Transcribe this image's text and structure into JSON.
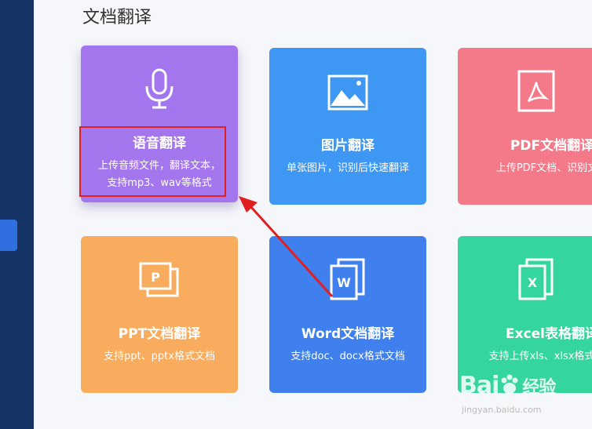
{
  "sidebar": {
    "active_color": "#2f6fe0",
    "bg_color": "#163366"
  },
  "page_title": "文档翻译",
  "cards": [
    {
      "title": "语音翻译",
      "desc_lines": [
        "上传音频文件，翻译文本，",
        "支持mp3、wav等格式"
      ],
      "icon": "microphone-icon",
      "color": "#a476ee"
    },
    {
      "title": "图片翻译",
      "desc_lines": [
        "单张图片，识别后快速翻译"
      ],
      "icon": "image-icon",
      "color": "#3e98f3"
    },
    {
      "title": "PDF文档翻译",
      "desc_lines": [
        "上传PDF文档、识别文档"
      ],
      "icon": "pdf-file-icon",
      "color": "#f47a8a"
    },
    {
      "title": "PPT文档翻译",
      "desc_lines": [
        "支持ppt、pptx格式文档"
      ],
      "icon": "ppt-file-icon",
      "icon_letter": "P",
      "color": "#f9ac5d"
    },
    {
      "title": "Word文档翻译",
      "desc_lines": [
        "支持doc、docx格式文档"
      ],
      "icon": "word-file-icon",
      "icon_letter": "W",
      "color": "#3f7fee"
    },
    {
      "title": "Excel表格翻译",
      "desc_lines": [
        "支持上传xls、xlsx格式文档"
      ],
      "icon": "excel-file-icon",
      "icon_letter": "X",
      "color": "#34d69e"
    }
  ],
  "annotation": {
    "color": "#e02020"
  },
  "watermark": {
    "brand": "Bai",
    "brand_suffix": "经验",
    "url": "jingyan.baidu.com"
  }
}
